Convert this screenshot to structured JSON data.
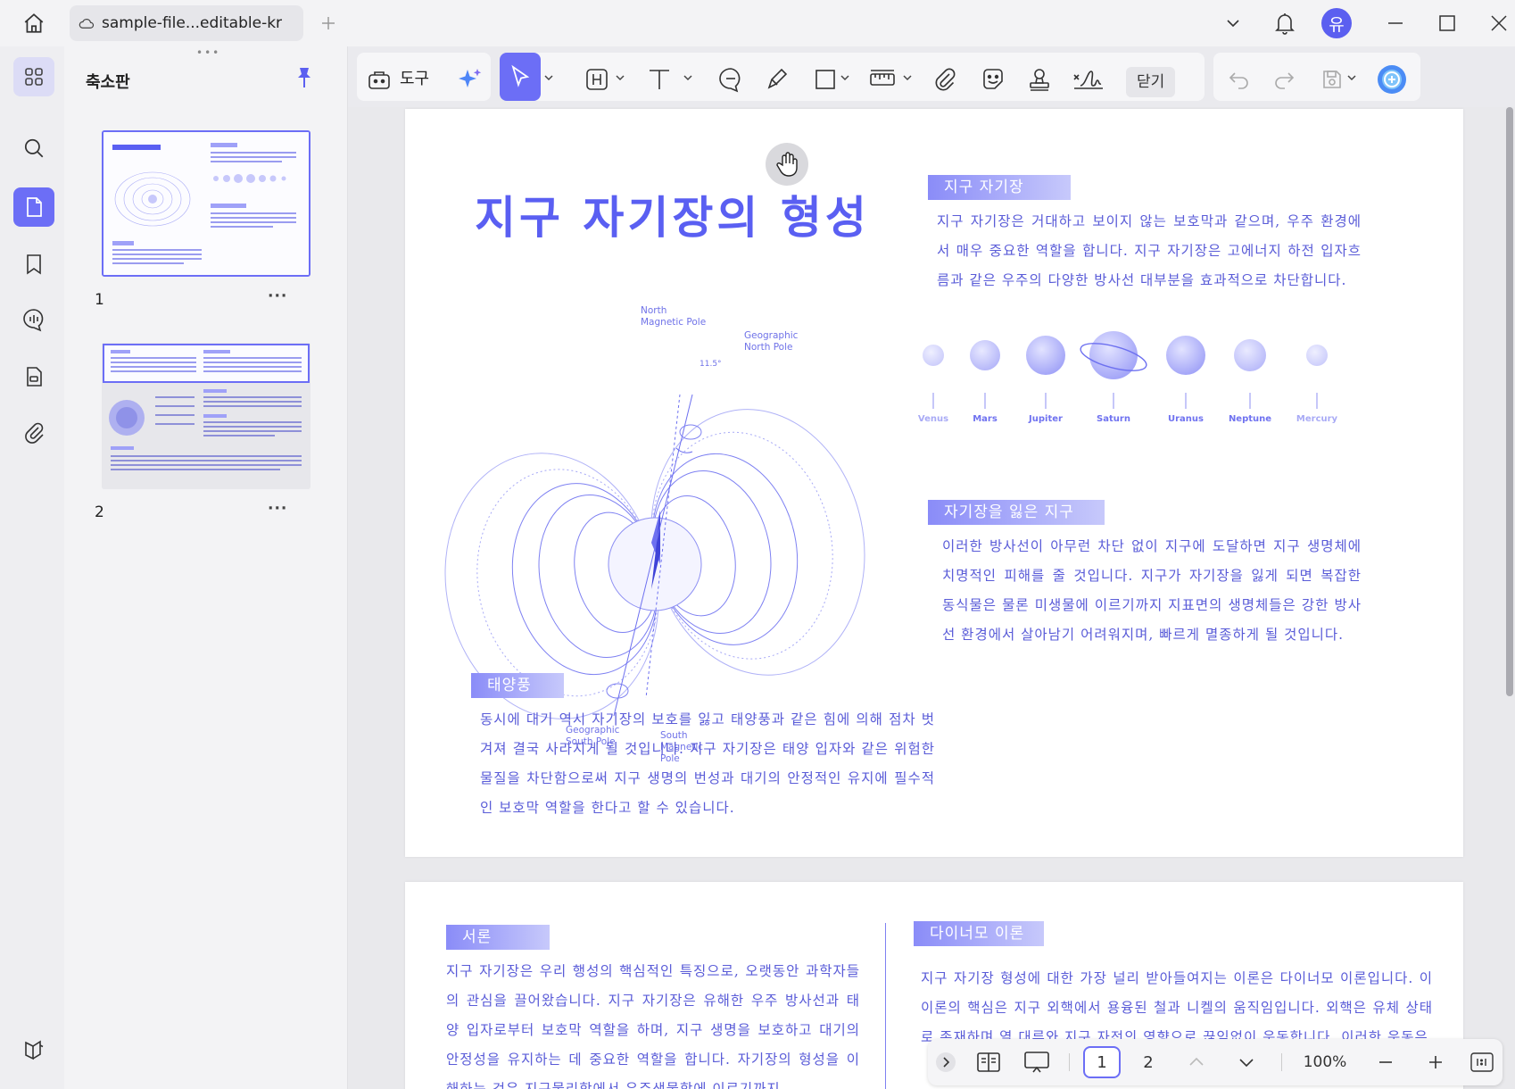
{
  "window": {
    "tab_title": "sample-file...editable-kr",
    "user_avatar": "유"
  },
  "panel": {
    "title": "축소판",
    "pages": [
      {
        "number": "1",
        "more": "···"
      },
      {
        "number": "2",
        "more": "···"
      }
    ]
  },
  "toolbar": {
    "tools_label": "도구",
    "close_label": "닫기"
  },
  "page1": {
    "title": "지구 자기장의 형성",
    "section_magnetic": {
      "tag": "지구 자기장",
      "text": "지구 자기장은 거대하고 보이지 않는 보호막과 같으며, 우주 환경에서 매우 중요한 역할을 합니다. 지구 자기장은 고에너지 하전 입자흐름과 같은 우주의 다양한 방사선 대부분을 효과적으로 차단합니다."
    },
    "planets": [
      "Venus",
      "Mars",
      "Jupiter",
      "Saturn",
      "Uranus",
      "Neptune",
      "Mercury"
    ],
    "section_lost": {
      "tag": "자기장을 잃은 지구",
      "text": "이러한 방사선이 아무런 차단 없이 지구에 도달하면 지구 생명체에 치명적인 피해를 줄 것입니다. 지구가 자기장을 잃게 되면 복잡한 동식물은 물론 미생물에 이르기까지 지표면의 생명체들은 강한 방사선 환경에서 살아남기 어려워지며, 빠르게 멸종하게 될 것입니다."
    },
    "section_wind": {
      "tag": "태양풍",
      "text": "동시에 대기 역시 자기장의 보호를 잃고 태양풍과 같은 힘에 의해 점차 벗겨져 결국 사라지게 될 것입니다. 지구 자기장은 태양 입자와 같은 위험한 물질을 차단함으로써 지구 생명의 번성과 대기의 안정적인 유지에 필수적인 보호막 역할을 한다고 할 수 있습니다."
    },
    "diagram": {
      "north_magnetic": [
        "North",
        "Magnetic Pole"
      ],
      "geo_north": [
        "Geographic",
        "North Pole"
      ],
      "geo_south": [
        "Geographic",
        "South Pole"
      ],
      "south_magnetic": [
        "South",
        "Magnetic",
        "Pole"
      ],
      "angle": "11.5°"
    }
  },
  "page2": {
    "section_intro": {
      "tag": "서론",
      "text": "지구 자기장은 우리 행성의 핵심적인 특징으로, 오랫동안 과학자들의 관심을 끌어왔습니다. 지구 자기장은 유해한 우주 방사선과 태양 입자로부터 보호막 역할을 하며, 지구 생명을 보호하고 대기의 안정성을 유지하는 데 중요한 역할을 합니다. 자기장의 형성을 이해하는 것은 지구물리학에서 우주생물학에 이르기까지"
    },
    "section_dynamo": {
      "tag": "다이너모 이론",
      "text": "지구 자기장 형성에 대한 가장 널리 받아들여지는 이론은 다이너모 이론입니다. 이 이론의 핵심은 지구 외핵에서 용융된 철과 니켈의 움직임입니다. 외핵은 유체 상태로 존재하며 열 대류와 지구 자전의 영향으로 끊임없이 운동합니다. 이러한 운동은"
    }
  },
  "bottom_nav": {
    "pages": [
      "1",
      "2"
    ],
    "zoom": "100%"
  },
  "colors": {
    "accent": "#6c6ef6",
    "doc_text": "#5a5cd8",
    "doc_title": "#5a5ff2"
  },
  "icons": [
    "home-icon",
    "cloud-icon",
    "add-tab-icon",
    "chevron-down-icon",
    "bell-icon",
    "minimize-icon",
    "maximize-icon",
    "close-window-icon",
    "thumbnails-icon",
    "search-icon",
    "pages-icon",
    "bookmark-icon",
    "comment-icon",
    "form-icon",
    "attachment-icon",
    "layers-icon",
    "pin-icon",
    "toolbox-icon",
    "ai-sparkle-icon",
    "cursor-icon",
    "highlight-icon",
    "text-icon",
    "note-icon",
    "pen-icon",
    "rectangle-icon",
    "ruler-icon",
    "clip-icon",
    "sticker-icon",
    "stamp-icon",
    "signature-icon",
    "undo-icon",
    "redo-icon",
    "save-icon",
    "assistant-icon",
    "hand-icon"
  ]
}
